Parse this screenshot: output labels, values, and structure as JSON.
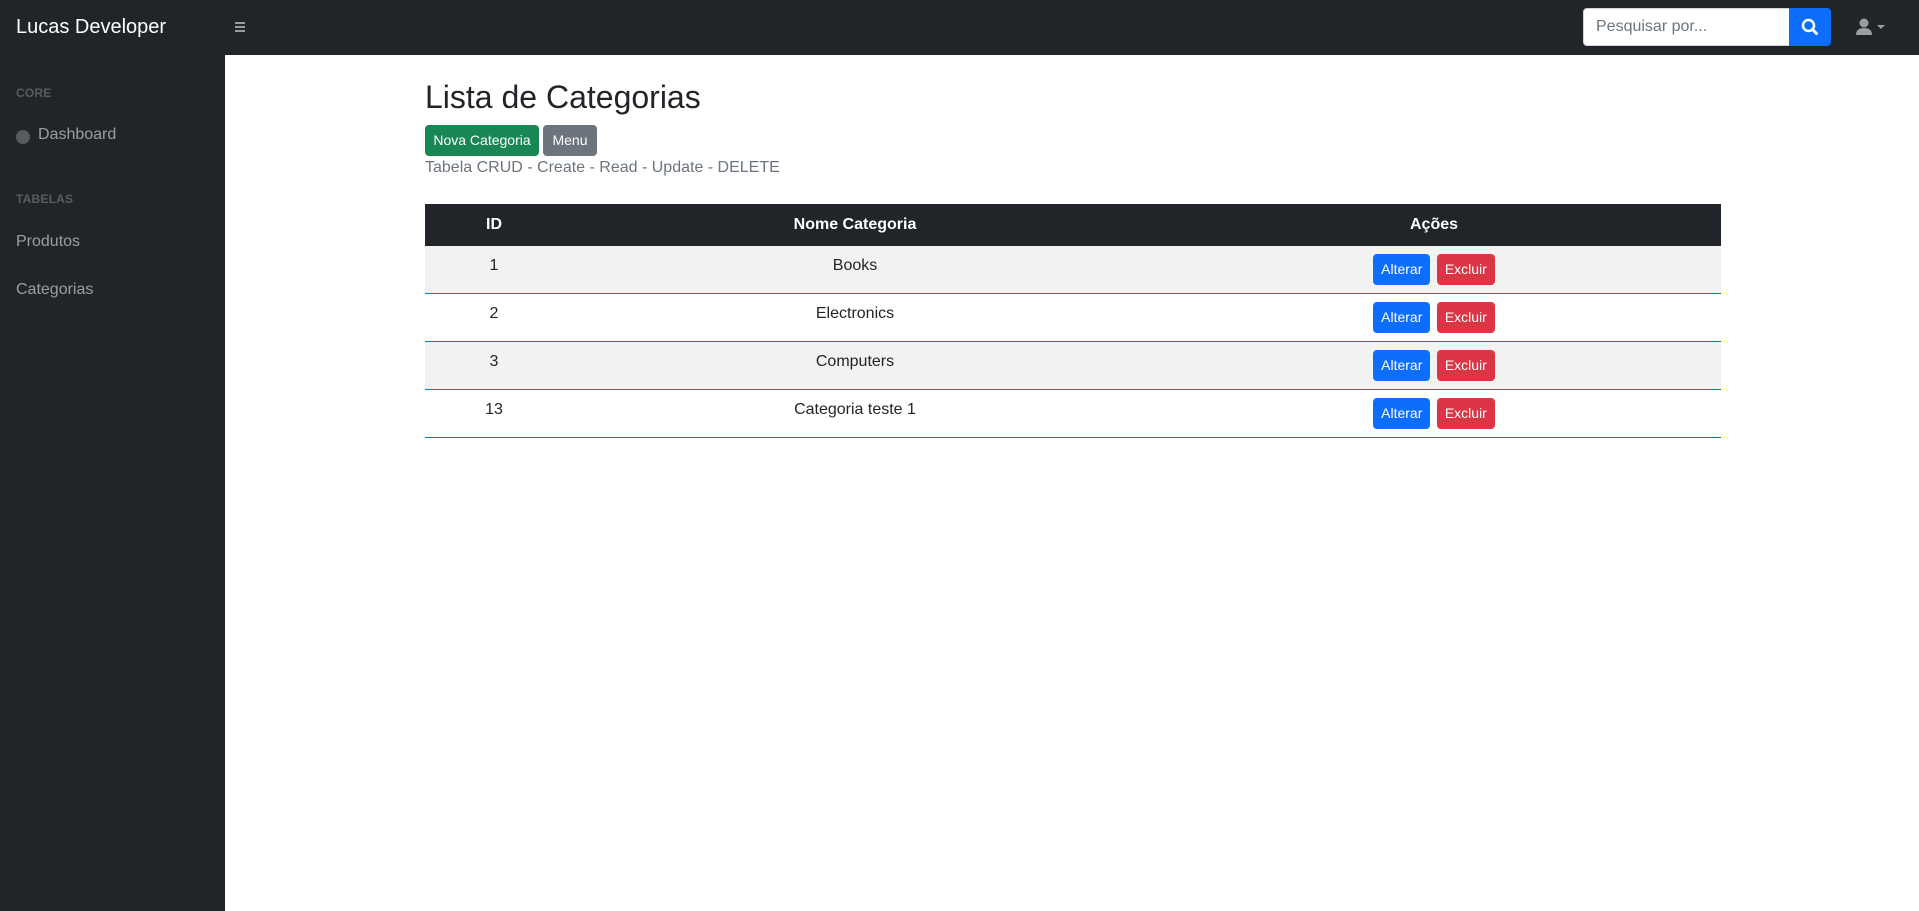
{
  "navbar": {
    "brand": "Lucas Developer",
    "search_placeholder": "Pesquisar por..."
  },
  "sidebar": {
    "core_heading": "CORE",
    "dashboard": "Dashboard",
    "tables_heading": "TABELAS",
    "produtos": "Produtos",
    "categorias": "Categorias"
  },
  "main": {
    "title": "Lista de Categorias",
    "new_button": "Nova Categoria",
    "menu_button": "Menu",
    "subtitle": "Tabela CRUD - Create - Read - Update - DELETE"
  },
  "table": {
    "headers": [
      "ID",
      "Nome Categoria",
      "Ações"
    ],
    "rows": [
      {
        "id": "1",
        "name": "Books"
      },
      {
        "id": "2",
        "name": "Electronics"
      },
      {
        "id": "3",
        "name": "Computers"
      },
      {
        "id": "13",
        "name": "Categoria teste 1"
      }
    ],
    "edit_label": "Alterar",
    "delete_label": "Excluir"
  },
  "colors": {
    "dark": "#212529",
    "primary": "#0d6efd",
    "success": "#198754",
    "secondary": "#6c757d",
    "danger": "#dc3545"
  }
}
